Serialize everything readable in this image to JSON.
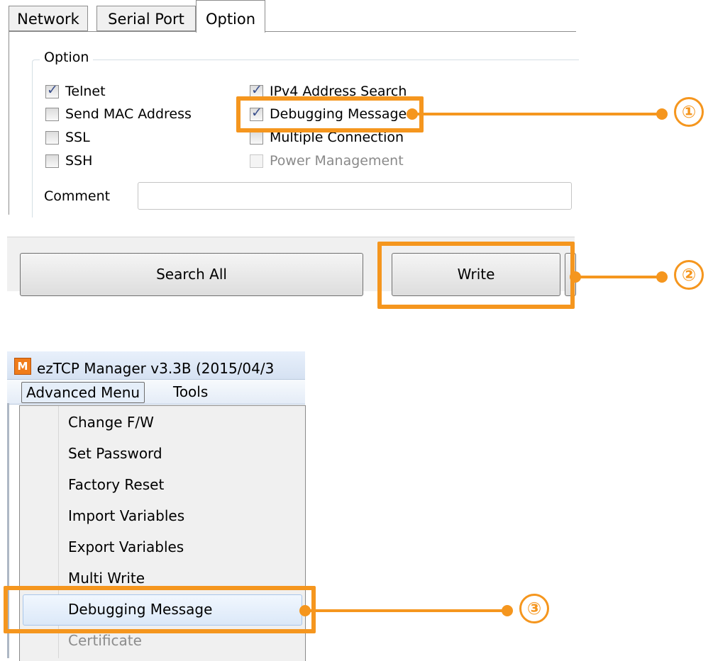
{
  "tabs": [
    "Network",
    "Serial Port",
    "Option"
  ],
  "option_group": {
    "title": "Option",
    "left_checks": [
      {
        "label": "Telnet",
        "checked": true
      },
      {
        "label": "Send MAC Address",
        "checked": false
      },
      {
        "label": "SSL",
        "checked": false
      },
      {
        "label": "SSH",
        "checked": false
      }
    ],
    "right_checks": [
      {
        "label": "IPv4 Address Search",
        "checked": true
      },
      {
        "label": "Debugging Message",
        "checked": true
      },
      {
        "label": "Multiple Connection",
        "checked": false
      },
      {
        "label": "Power Management",
        "checked": false,
        "disabled": true
      }
    ],
    "comment_label": "Comment",
    "comment_value": ""
  },
  "buttons": {
    "search_all": "Search All",
    "write": "Write"
  },
  "window": {
    "icon_letter": "M",
    "title": "ezTCP Manager v3.3B (2015/04/3"
  },
  "menubar": [
    "Advanced Menu",
    "Tools"
  ],
  "advanced_menu": [
    {
      "label": "Change F/W"
    },
    {
      "label": "Set Password"
    },
    {
      "label": "Factory Reset"
    },
    {
      "label": "Import Variables"
    },
    {
      "label": "Export Variables"
    },
    {
      "label": "Multi Write"
    },
    {
      "label": "Debugging Message",
      "highlighted": true
    },
    {
      "label": "Certificate",
      "disabled": true
    }
  ],
  "callouts": [
    "①",
    "②",
    "③"
  ],
  "colors": {
    "accent": "#f5961e"
  }
}
